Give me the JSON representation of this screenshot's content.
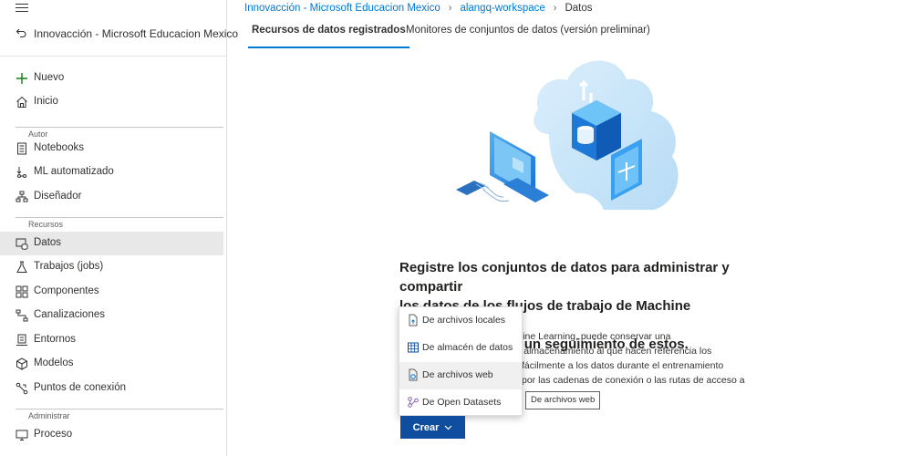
{
  "breadcrumb": {
    "items": [
      "Innovacción - Microsoft Educacion Mexico",
      "alangq-workspace"
    ],
    "current": "Datos"
  },
  "sidebar": {
    "workspace": "Innovacción - Microsoft Educacion Mexico",
    "new_label": "Nuevo",
    "home_label": "Inicio",
    "sections": {
      "author": "Autor",
      "assets": "Recursos",
      "manage": "Administrar"
    },
    "author_items": [
      "Notebooks",
      "ML automatizado",
      "Diseñador"
    ],
    "asset_items": [
      "Datos",
      "Trabajos (jobs)",
      "Componentes",
      "Canalizaciones",
      "Entornos",
      "Modelos",
      "Puntos de conexión"
    ],
    "manage_items": [
      "Proceso"
    ],
    "active_item": "Datos"
  },
  "tabs": [
    "Recursos de datos registrados",
    "Monitores de conjuntos de datos (versión preliminar)"
  ],
  "main": {
    "heading_lines": [
      "Registre los conjuntos de datos para administrar y compartir",
      "los datos de los flujos de trabajo de Machine Learning, así",
      "como para realizar un seguimiento de estos."
    ],
    "body_lines": [
      "e Azure Machine Learning, puede conservar una",
      "l almacenamiento al que hacen referencia los",
      "fácilmente a los datos durante el entrenamiento",
      "por las cadenas de conexión o las rutas de acceso a"
    ]
  },
  "create_menu": {
    "items": [
      "De archivos locales",
      "De almacén de datos",
      "De archivos web",
      "De Open Datasets"
    ],
    "hovered": "De archivos web",
    "tooltip": "De archivos web"
  },
  "create_button": "Crear",
  "colors": {
    "accent": "#0078d4",
    "button": "#0f4e9e"
  }
}
